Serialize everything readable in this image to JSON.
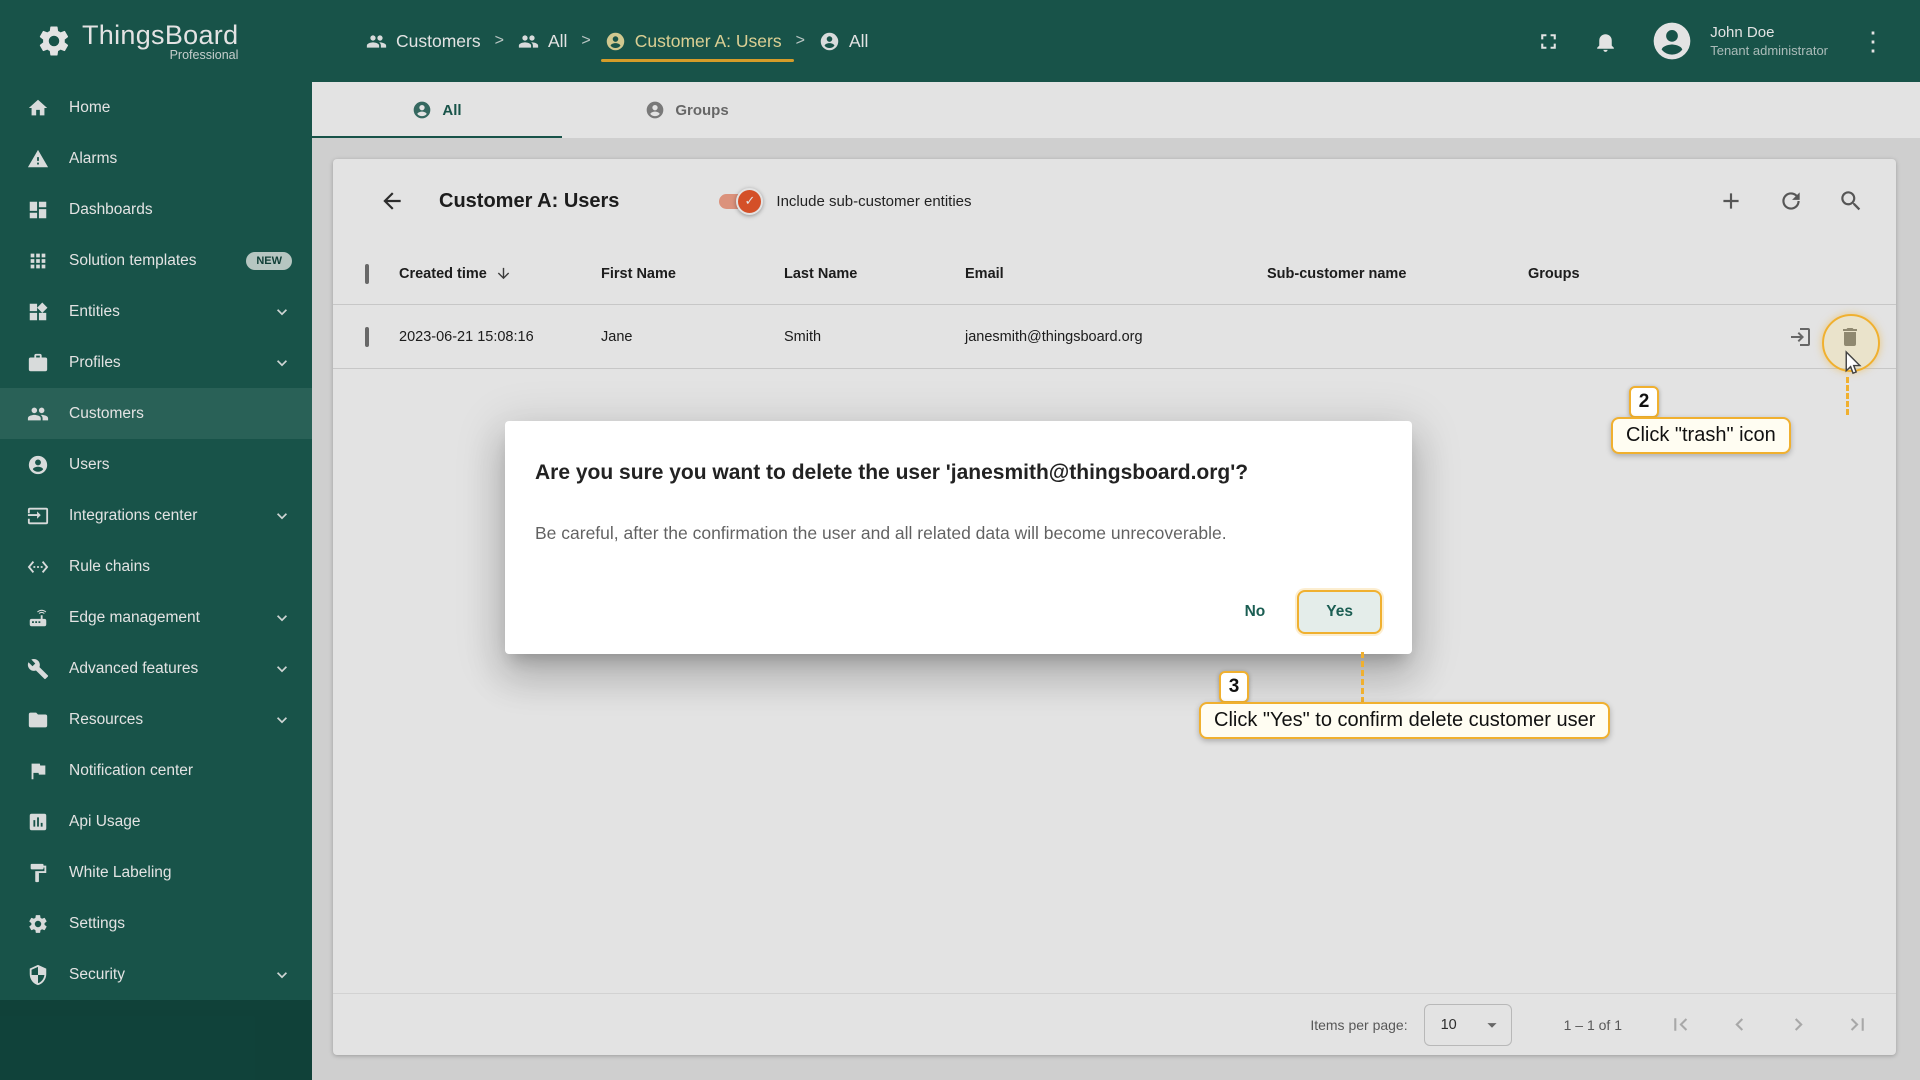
{
  "brand": {
    "name": "ThingsBoard",
    "edition": "Professional"
  },
  "topbar": {
    "separator": ">",
    "breadcrumbs": [
      {
        "label": "Customers",
        "icon": "people-icon"
      },
      {
        "label": "All",
        "icon": "people-icon"
      },
      {
        "label": "Customer A: Users",
        "icon": "user-icon",
        "highlighted": true
      },
      {
        "label": "All",
        "icon": "user-icon"
      }
    ],
    "user": {
      "name": "John Doe",
      "role": "Tenant administrator"
    }
  },
  "sidebar": {
    "items": [
      {
        "label": "Home",
        "icon": "home-icon"
      },
      {
        "label": "Alarms",
        "icon": "alarms-icon"
      },
      {
        "label": "Dashboards",
        "icon": "dashboards-icon"
      },
      {
        "label": "Solution templates",
        "icon": "solution-templates-icon",
        "badge": "NEW"
      },
      {
        "label": "Entities",
        "icon": "entities-icon",
        "expandable": true
      },
      {
        "label": "Profiles",
        "icon": "profiles-icon",
        "expandable": true
      },
      {
        "label": "Customers",
        "icon": "customers-icon",
        "active": true
      },
      {
        "label": "Users",
        "icon": "users-icon"
      },
      {
        "label": "Integrations center",
        "icon": "integrations-icon",
        "expandable": true
      },
      {
        "label": "Rule chains",
        "icon": "rule-chains-icon"
      },
      {
        "label": "Edge management",
        "icon": "edge-icon",
        "expandable": true
      },
      {
        "label": "Advanced features",
        "icon": "advanced-features-icon",
        "expandable": true
      },
      {
        "label": "Resources",
        "icon": "resources-icon",
        "expandable": true
      },
      {
        "label": "Notification center",
        "icon": "notification-icon"
      },
      {
        "label": "Api Usage",
        "icon": "api-usage-icon"
      },
      {
        "label": "White Labeling",
        "icon": "white-labeling-icon"
      },
      {
        "label": "Settings",
        "icon": "settings-icon"
      },
      {
        "label": "Security",
        "icon": "security-icon",
        "expandable": true
      }
    ]
  },
  "tabs": [
    {
      "label": "All",
      "active": true
    },
    {
      "label": "Groups",
      "active": false
    }
  ],
  "toolbar": {
    "title": "Customer A: Users",
    "toggle_label": "Include sub-customer entities",
    "toggle_checked": true
  },
  "table": {
    "columns": [
      "Created time",
      "First Name",
      "Last Name",
      "Email",
      "Sub-customer name",
      "Groups"
    ],
    "rows": [
      {
        "created_time": "2023-06-21 15:08:16",
        "first_name": "Jane",
        "last_name": "Smith",
        "email": "janesmith@thingsboard.org",
        "sub_customer": "",
        "groups": ""
      }
    ]
  },
  "dialog": {
    "title": "Are you sure you want to delete the user 'janesmith@thingsboard.org'?",
    "message": "Be careful, after the confirmation the user and all related data will become unrecoverable.",
    "no_label": "No",
    "yes_label": "Yes"
  },
  "annotations": [
    {
      "step": "2",
      "label": "Click \"trash\" icon"
    },
    {
      "step": "3",
      "label": "Click \"Yes\" to confirm delete customer user"
    }
  ],
  "pagination": {
    "items_per_page_label": "Items per page:",
    "items_per_page": "10",
    "range": "1 – 1 of 1"
  },
  "icons": {
    "menu_kebab": "⋮",
    "toggle_check": "✓"
  },
  "colors": {
    "primary": "#1b5e53",
    "sidebar_active": "#2f6e62",
    "annotation": "#f0b02f",
    "toggle": "#ef5a2e"
  }
}
